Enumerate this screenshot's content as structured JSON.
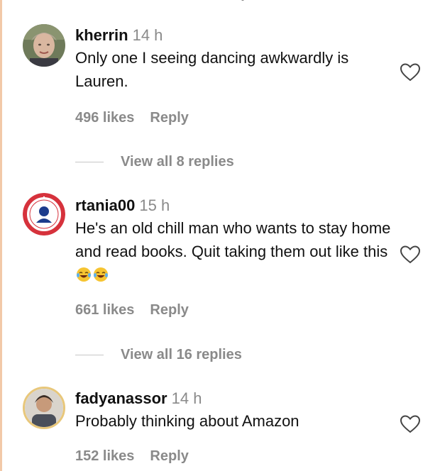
{
  "comments": [
    {
      "username": "kherrin",
      "time": "14 h",
      "text": "Only one I seeing dancing awkwardly is Lauren.",
      "likes": "496 likes",
      "reply": "Reply",
      "view_replies": "View all 8 replies",
      "avatar": "portrait-photo"
    },
    {
      "username": "rtania00",
      "time": "15 h",
      "text": "He's an old chill man who wants to stay home and read books. Quit taking them out like this",
      "emoji": "😂😂",
      "likes": "661 likes",
      "reply": "Reply",
      "view_replies": "View all 16 replies",
      "avatar": "red-circular-badge"
    },
    {
      "username": "fadyanassor",
      "time": "14 h",
      "text": "Probably thinking about Amazon",
      "likes": "152 likes",
      "reply": "Reply",
      "avatar": "portrait-photo-ring"
    }
  ],
  "icons": {
    "like": "heart-outline-icon"
  },
  "colors": {
    "username": "#111111",
    "meta": "#8a8a8a",
    "divider": "#c7c7c7",
    "badge_red": "#d6323c"
  }
}
